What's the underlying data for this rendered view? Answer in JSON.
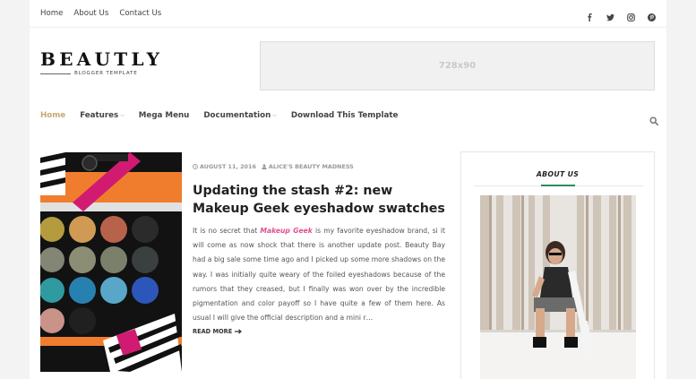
{
  "topbar": {
    "links": [
      "Home",
      "About Us",
      "Contact Us"
    ],
    "social_icons": [
      "facebook-icon",
      "twitter-icon",
      "instagram-icon",
      "pinterest-icon"
    ]
  },
  "header": {
    "logo_title": "BEAUTLY",
    "logo_subtitle": "BLOGGER TEMPLATE",
    "ad_label": "728x90"
  },
  "nav": {
    "items": [
      {
        "label": "Home",
        "active": true,
        "dropdown": false
      },
      {
        "label": "Features",
        "active": false,
        "dropdown": true
      },
      {
        "label": "Mega Menu",
        "active": false,
        "dropdown": false
      },
      {
        "label": "Documentation",
        "active": false,
        "dropdown": true
      },
      {
        "label": "Download This Template",
        "active": false,
        "dropdown": false
      }
    ],
    "search_icon": "search-icon"
  },
  "post": {
    "date": "AUGUST 11, 2016",
    "author": "ALICE'S BEAUTY MADNESS",
    "title": "Updating the stash #2: new Makeup Geek eyeshadow swatches",
    "excerpt_before": "It is no secret that ",
    "excerpt_link": "Makeup Geek",
    "excerpt_after": " is my favorite eyeshadow brand, si it will come as now shock that there is another update post. Beauty Bay had a big sale some time ago and I picked up some more shadows on the way. I was initially quite weary of the foiled eyeshadows because of the rumors that they creased, but I finally was won over by the incredible pigmentation and color payoff so I have quite a few of them here. As usual I will give the official description and a mini r…",
    "read_more": "READ MORE"
  },
  "sidebar": {
    "widget_title": "ABOUT US"
  },
  "colors": {
    "accent": "#c8a771",
    "link_pink": "#e04e8e",
    "widget_accent": "#2e8b57"
  }
}
